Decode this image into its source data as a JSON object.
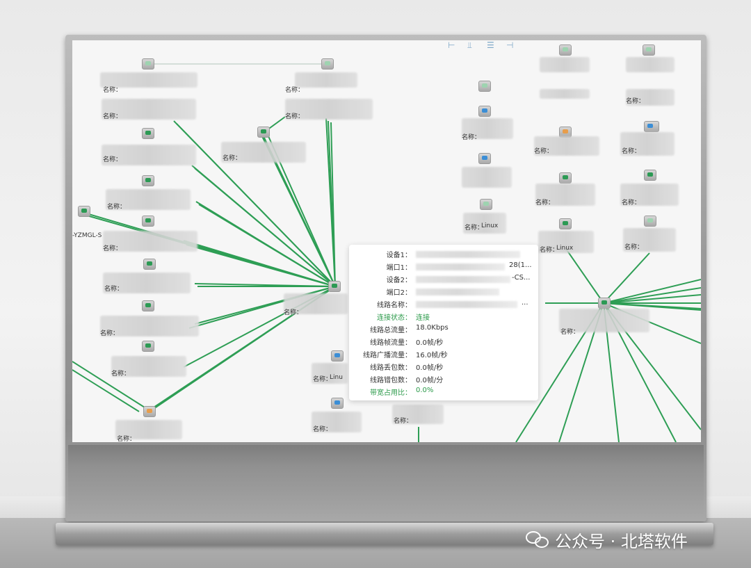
{
  "topology": {
    "partial_node_label": "-YZMGL-S",
    "name_prefix": "名称：",
    "linux_labels": [
      "Linux",
      "Linux",
      "Linu",
      "Linux"
    ]
  },
  "popup": {
    "rows": [
      {
        "key": "设备1：",
        "value": ""
      },
      {
        "key": "端口1：",
        "value": "28(1..."
      },
      {
        "key": "设备2：",
        "value": "-CS..."
      },
      {
        "key": "端口2：",
        "value": ""
      },
      {
        "key": "线路名称：",
        "value": "..."
      },
      {
        "key": "连接状态：",
        "value": "连接"
      },
      {
        "key": "线路总流量：",
        "value": "18.0Kbps"
      },
      {
        "key": "线路帧流量：",
        "value": "0.0帧/秒"
      },
      {
        "key": "线路广播流量：",
        "value": "16.0帧/秒"
      },
      {
        "key": "线路丢包数：",
        "value": "0.0帧/秒"
      },
      {
        "key": "线路错包数：",
        "value": "0.0帧/分"
      },
      {
        "key": "带宽占用比：",
        "value": "0.0%"
      }
    ]
  },
  "watermark": {
    "text": "公众号 · 北塔软件"
  },
  "colors": {
    "link": "#2e9e55",
    "status_green": "#2b9a4a",
    "screen_bg": "#f6f6f6"
  }
}
